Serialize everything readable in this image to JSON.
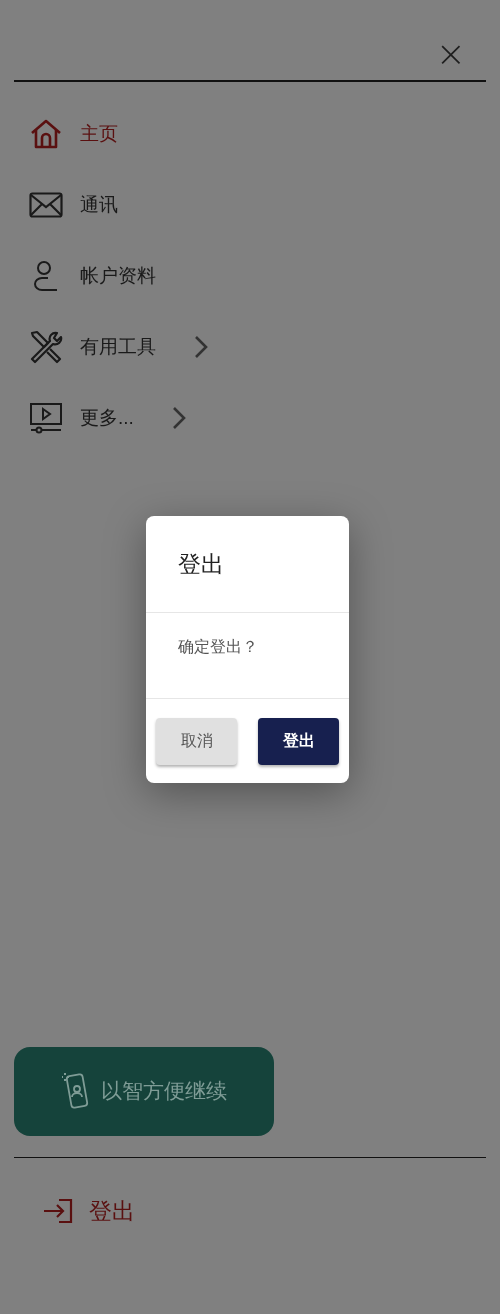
{
  "close_button": {
    "label": "×"
  },
  "menu": {
    "items": [
      {
        "label": "主页",
        "selected": true,
        "has_submenu": false
      },
      {
        "label": "通讯",
        "selected": false,
        "has_submenu": false
      },
      {
        "label": "帐户资料",
        "selected": false,
        "has_submenu": false
      },
      {
        "label": "有用工具",
        "selected": false,
        "has_submenu": true
      },
      {
        "label": "更多...",
        "selected": false,
        "has_submenu": true
      }
    ]
  },
  "dialog": {
    "title": "登出",
    "message": "确定登出？",
    "buttons": [
      {
        "label": "取消",
        "kind": "secondary"
      },
      {
        "label": "登出",
        "kind": "primary"
      }
    ]
  },
  "continue_button": {
    "label": "以智方便继续"
  },
  "logout": {
    "label": "登出"
  }
}
